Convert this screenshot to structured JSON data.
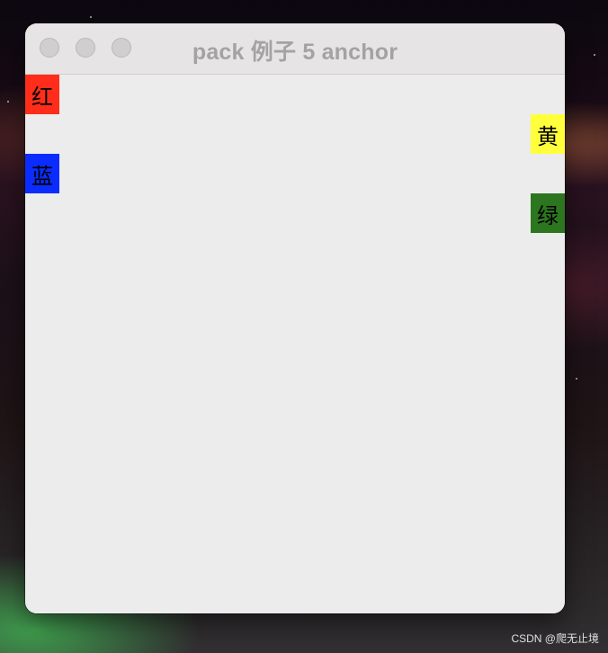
{
  "window": {
    "title": "pack 例子 5 anchor"
  },
  "labels": {
    "red": "红",
    "yellow": "黄",
    "blue": "蓝",
    "green": "绿"
  },
  "colors": {
    "red": "#ff2d1a",
    "yellow": "#ffff3c",
    "blue": "#0a2cff",
    "green": "#2d7620",
    "window_bg": "#ececec",
    "title_text": "#a3a3a3"
  },
  "watermark": "CSDN @爬无止境"
}
